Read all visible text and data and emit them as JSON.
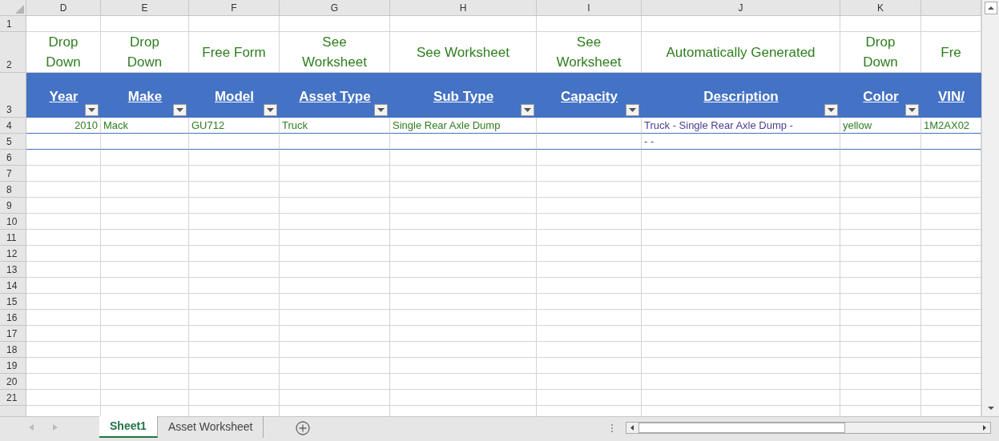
{
  "column_letters": [
    "D",
    "E",
    "F",
    "G",
    "H",
    "I",
    "J",
    "K"
  ],
  "rows": [
    {
      "number": "1",
      "kind": "blank",
      "cells": []
    },
    {
      "number": "2",
      "kind": "note",
      "cells": [
        "Drop\nDown",
        "Drop\nDown",
        "Free Form",
        "See\nWorksheet",
        "See Worksheet",
        "See\nWorksheet",
        "Automatically Generated",
        "Drop\nDown",
        "Fre"
      ]
    },
    {
      "number": "3",
      "kind": "header",
      "cells": [
        "Year",
        "Make",
        "Model",
        "Asset Type",
        "Sub Type",
        "Capacity",
        "Description",
        "Color",
        "VIN/"
      ]
    },
    {
      "number": "4",
      "kind": "data",
      "cells": [
        {
          "text": "2010",
          "kind": "number"
        },
        {
          "text": "Mack",
          "kind": "text"
        },
        {
          "text": "GU712",
          "kind": "text"
        },
        {
          "text": "Truck",
          "kind": "text"
        },
        {
          "text": "Single Rear Axle Dump",
          "kind": "text"
        },
        null,
        {
          "text": "Truck - Single Rear Axle Dump -",
          "kind": "generated"
        },
        {
          "text": "yellow",
          "kind": "text"
        },
        {
          "text": "1M2AX02",
          "kind": "text"
        }
      ]
    },
    {
      "number": "5",
      "kind": "data",
      "cells": [
        null,
        null,
        null,
        null,
        null,
        null,
        {
          "text": "- -",
          "kind": "generated"
        },
        null,
        null
      ]
    },
    {
      "number": "6",
      "kind": "blank",
      "cells": []
    },
    {
      "number": "7",
      "kind": "blank",
      "cells": []
    },
    {
      "number": "8",
      "kind": "blank",
      "cells": []
    },
    {
      "number": "9",
      "kind": "blank",
      "cells": []
    },
    {
      "number": "10",
      "kind": "blank",
      "cells": []
    },
    {
      "number": "11",
      "kind": "blank",
      "cells": []
    },
    {
      "number": "12",
      "kind": "blank",
      "cells": []
    },
    {
      "number": "13",
      "kind": "blank",
      "cells": []
    },
    {
      "number": "14",
      "kind": "blank",
      "cells": []
    },
    {
      "number": "15",
      "kind": "blank",
      "cells": []
    },
    {
      "number": "16",
      "kind": "blank",
      "cells": []
    },
    {
      "number": "17",
      "kind": "blank",
      "cells": []
    },
    {
      "number": "18",
      "kind": "blank",
      "cells": []
    },
    {
      "number": "19",
      "kind": "blank",
      "cells": []
    },
    {
      "number": "20",
      "kind": "blank",
      "cells": []
    },
    {
      "number": "21",
      "kind": "blank",
      "cells": []
    }
  ],
  "sheet_tabs": [
    {
      "label": "Sheet1",
      "selected": true
    },
    {
      "label": "Asset Worksheet",
      "selected": false
    }
  ]
}
